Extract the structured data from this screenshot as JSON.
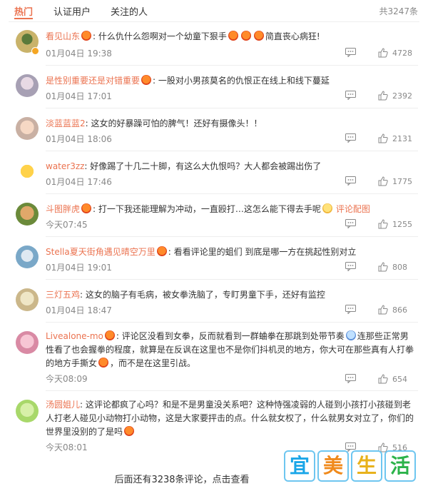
{
  "tabs": {
    "items": [
      {
        "label": "热门",
        "active": true
      },
      {
        "label": "认证用户",
        "active": false
      },
      {
        "label": "关注的人",
        "active": false
      }
    ],
    "total": "共3247条"
  },
  "comments": [
    {
      "user": "看见山东",
      "text": "什么仇什么怨啊对一个幼童下狠手",
      "after_emoji": "简直丧心病狂!",
      "time": "01月04日 19:38",
      "likes": "4728"
    },
    {
      "user": "是性别重要还是对错重要",
      "text": "一股对小男孩莫名的仇恨正在线上和线下蔓延",
      "time": "01月04日 17:01",
      "likes": "2392"
    },
    {
      "user": "淡蓝蓝蓝2",
      "text": "这女的好暴躁可怕的脾气！还好有摄像头！！",
      "time": "01月04日 18:06",
      "likes": "2131"
    },
    {
      "user": "water3zz",
      "text": "好像踢了十几二十脚，有这么大仇恨吗？大人都会被踢出伤了",
      "time": "01月04日 17:46",
      "likes": "1775"
    },
    {
      "user": "斗图胖虎",
      "text": "打一下我还能理解为冲动，一直殴打…这怎么能下得去手呢",
      "pic_link": "评论配图",
      "time": "今天07:45",
      "likes": "1255"
    },
    {
      "user": "Stella夏天街角遇见晴空万里",
      "text": "看看评论里的蛆们 到底是哪一方在挑起性别对立",
      "time": "01月04日 19:01",
      "likes": "808"
    },
    {
      "user": "三灯五鸡",
      "text": "这女的脑子有毛病，被女拳洗脑了，专盯男童下手，还好有监控",
      "time": "01月04日 18:47",
      "likes": "866"
    },
    {
      "user": "Livealone-mo",
      "text_part1": "评论区没看到女拳，反而就看到一群蛐拳在那跳到处带节奏",
      "text_part2": "连那些正常男性看了也会握拳的程度，就算是在反讽在这里也不是你们抖机灵的地方，你大可在那些真有人打拳的地方手撕女",
      "text_part3": "，而不是在这里引战。",
      "time": "今天08:09",
      "likes": "654"
    },
    {
      "user": "汤圆姐儿",
      "text": "这评论都疯了心吗？和是不是男童没关系吧？这种恃强凌弱的人碰到小孩打小孩碰到老人打老人碰见小动物打小动物，这是大家要抨击的点。什么就女权了，什么就男女对立了，你们的世界里没别的了是吗",
      "time": "今天08:01",
      "likes": "516"
    }
  ],
  "more_link": "后面还有3238条评论，点击查看",
  "watermark": {
    "chars": [
      "宜",
      "美",
      "生",
      "活"
    ],
    "colors": [
      "#1aa6e8",
      "#f08a1c",
      "#e8b21c",
      "#2cb34a"
    ]
  }
}
